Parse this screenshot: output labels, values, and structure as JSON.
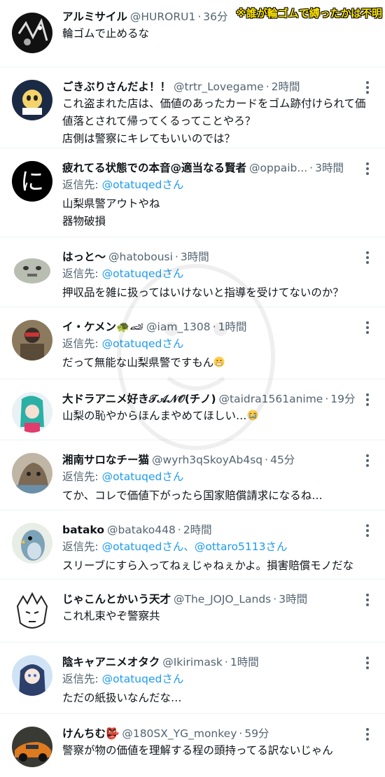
{
  "overlay_note": "※誰が輪ゴムで縛ったかは不明",
  "tweets": [
    {
      "name": "アルミサイル",
      "handle": "@HURORU1",
      "time": "36分",
      "reply_prefix": "",
      "reply_to": "",
      "lines": [
        "輪ゴムで止めるな"
      ]
    },
    {
      "name": "ごきぶりさんだよ！！",
      "handle": "@trtr_Lovegame",
      "time": "2時間",
      "reply_prefix": "",
      "reply_to": "",
      "lines": [
        "これ盗まれた店は、価値のあったカードをゴム跡付けられて価",
        "値落とされて帰ってくるってことやろ？",
        "店側は警察にキレてもいいのでは？"
      ]
    },
    {
      "name": "疲れてる状態での本音@適当なる賢者",
      "handle": "@oppaib...",
      "time": "3時間",
      "reply_prefix": "返信先: ",
      "reply_to": "@otatuqedさん",
      "lines": [
        "山梨県警アウトやね",
        "器物破損"
      ]
    },
    {
      "name": "はっと〜",
      "handle": "@hatobousi",
      "time": "3時間",
      "reply_prefix": "返信先: ",
      "reply_to": "@otatuqedさん",
      "lines": [
        "押収品を雑に扱ってはいけないと指導を受けてないのか？"
      ]
    },
    {
      "name": "イ・ケメン",
      "handle": "@iam_1308",
      "time": "1時間",
      "reply_prefix": "返信先: ",
      "reply_to": "@otatuqedさん",
      "lines": [
        "だって無能な山梨県警ですもん"
      ]
    },
    {
      "name": "大ドラアニメ好き𝒯𝒜𝒩𝒪(チノ)",
      "handle": "@taidra1561anime",
      "time": "19分",
      "reply_prefix": "",
      "reply_to": "",
      "lines": [
        "山梨の恥やからほんまやめてほしい…"
      ]
    },
    {
      "name": "湘南サロなチー猫",
      "handle": "@wyrh3qSkoyAb4sq",
      "time": "45分",
      "reply_prefix": "返信先: ",
      "reply_to": "@otatuqedさん",
      "lines": [
        "てか、コレで価値下がったら国家賠償請求になるね…"
      ]
    },
    {
      "name": "batako",
      "handle": "@batako448",
      "time": "2時間",
      "reply_prefix": "返信先: ",
      "reply_to": "@otatuqedさん、@ottaro5113さん",
      "lines": [
        "スリーブにすら入ってねぇじゃねぇかよ。損害賠償モノだな"
      ]
    },
    {
      "name": "じゃこんとかいう天才",
      "handle": "@The_JOJO_Lands",
      "time": "3時間",
      "reply_prefix": "",
      "reply_to": "",
      "lines": [
        "これ札束やぞ警察共"
      ]
    },
    {
      "name": "陰キャアニメオタク",
      "handle": "@Ikirimask",
      "time": "1時間",
      "reply_prefix": "返信先: ",
      "reply_to": "@otatuqedさん",
      "lines": [
        "ただの紙扱いなんだな…"
      ]
    },
    {
      "name": "けんちむ",
      "handle": "@180SX_YG_monkey",
      "time": "59分",
      "reply_prefix": "",
      "reply_to": "",
      "lines": [
        "警察が物の価値を理解する程の頭持ってる訳ないじゃん"
      ]
    }
  ]
}
